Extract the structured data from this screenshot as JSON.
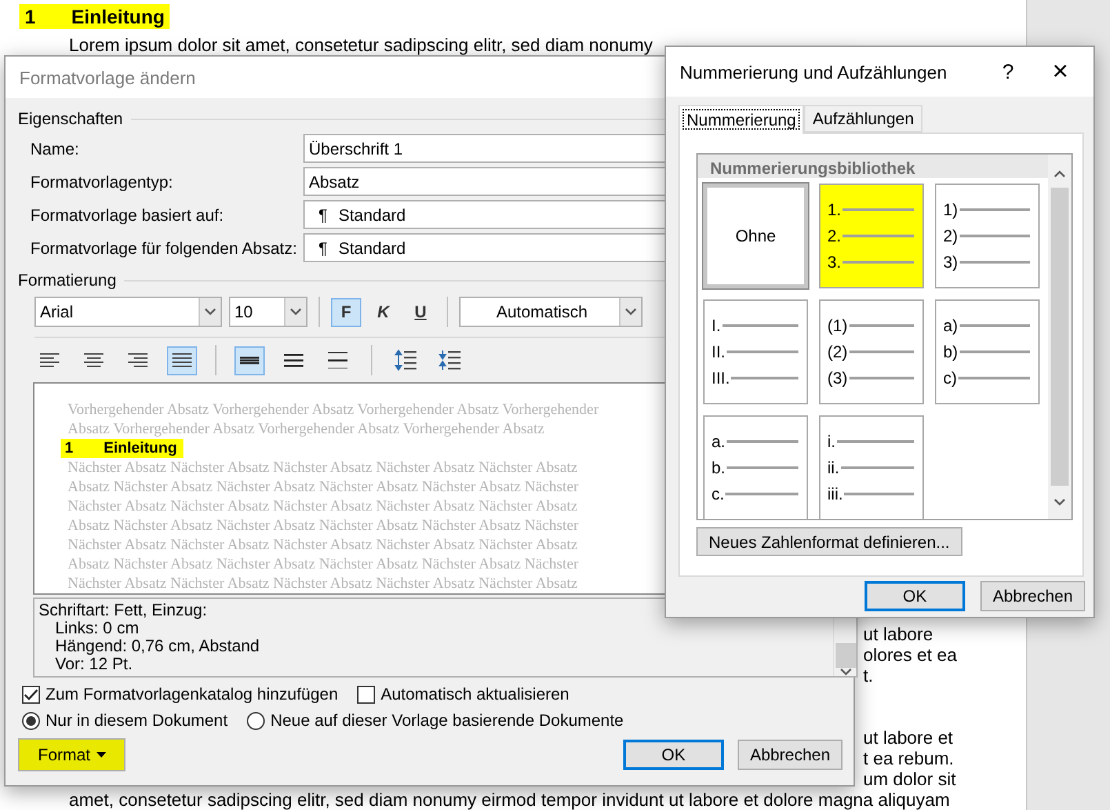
{
  "document": {
    "heading": {
      "number": "1",
      "text": "Einleitung",
      "highlighted": true
    },
    "top_line": "Lorem ipsum dolor sit amet, consetetur sadipscing elitr, sed diam nonumy",
    "fragments_upper": [
      "ut labore",
      "olores et ea",
      "t."
    ],
    "fragments_lower": [
      "ut labore et",
      "t ea rebum.",
      "um dolor sit"
    ],
    "bottom_line": "amet, consetetur sadipscing elitr, sed diam nonumy eirmod tempor invidunt ut labore et dolore magna aliquyam"
  },
  "style_dialog": {
    "title": "Formatvorlage ändern",
    "properties": {
      "label": "Eigenschaften",
      "rows": [
        {
          "label": "Name:",
          "value": "Überschrift 1",
          "kind": "text"
        },
        {
          "label": "Formatvorlagentyp:",
          "value": "Absatz",
          "kind": "text"
        },
        {
          "label": "Formatvorlage basiert auf:",
          "value": "Standard",
          "kind": "style",
          "symbol": "¶"
        },
        {
          "label": "Formatvorlage für folgenden Absatz:",
          "value": "Standard",
          "kind": "style",
          "symbol": "¶"
        }
      ]
    },
    "formatting": {
      "label": "Formatierung",
      "font": "Arial",
      "size": "10",
      "style_buttons": [
        {
          "label": "F",
          "kind": "bold",
          "selected": true
        },
        {
          "label": "K",
          "kind": "italic",
          "selected": false
        },
        {
          "label": "U",
          "kind": "underline",
          "selected": false
        }
      ],
      "color_choice": "Automatisch",
      "alignment": [
        {
          "kind": "left",
          "selected": false
        },
        {
          "kind": "center",
          "selected": false
        },
        {
          "kind": "right",
          "selected": false
        },
        {
          "kind": "justify",
          "selected": true
        }
      ],
      "line_spacing": [
        {
          "kind": "single",
          "selected": true
        },
        {
          "kind": "onehalf",
          "selected": false
        },
        {
          "kind": "double",
          "selected": false
        }
      ],
      "paragraph_spacing": [
        {
          "kind": "increase",
          "selected": false
        },
        {
          "kind": "decrease",
          "selected": false
        }
      ]
    },
    "preview": {
      "before": [
        "Vorhergehender Absatz Vorhergehender Absatz Vorhergehender Absatz Vorhergehender",
        "Absatz Vorhergehender Absatz Vorhergehender Absatz Vorhergehender Absatz"
      ],
      "heading": {
        "number": "1",
        "text": "Einleitung",
        "highlighted": true
      },
      "after": [
        "Nächster Absatz Nächster Absatz Nächster Absatz Nächster Absatz Nächster Absatz",
        "Absatz Nächster Absatz Nächster Absatz Nächster Absatz Nächster Absatz Nächster",
        "Nächster Absatz Nächster Absatz Nächster Absatz Nächster Absatz Nächster Absatz",
        "Absatz Nächster Absatz Nächster Absatz Nächster Absatz Nächster Absatz Nächster",
        "Nächster Absatz Nächster Absatz Nächster Absatz Nächster Absatz Nächster Absatz",
        "Absatz Nächster Absatz Nächster Absatz Nächster Absatz Nächster Absatz Nächster",
        "Nächster Absatz Nächster Absatz Nächster Absatz Nächster Absatz Nächster Absatz"
      ]
    },
    "description": [
      "Schriftart: Fett, Einzug:",
      "Links:  0 cm",
      "Hängend:  0,76 cm, Abstand",
      "Vor:  12 Pt."
    ],
    "checkboxes": [
      {
        "label": "Zum Formatvorlagenkatalog hinzufügen",
        "checked": true
      },
      {
        "label": "Automatisch aktualisieren",
        "checked": false
      }
    ],
    "radios": [
      {
        "label": "Nur in diesem Dokument",
        "selected": true
      },
      {
        "label": "Neue auf dieser Vorlage basierende Dokumente",
        "selected": false
      }
    ],
    "format_button": {
      "label": "Format",
      "highlighted": true
    },
    "buttons": [
      {
        "label": "OK",
        "default": true
      },
      {
        "label": "Abbrechen",
        "default": false
      }
    ]
  },
  "numbering_dialog": {
    "title": "Nummerierung und Aufzählungen",
    "help": "?",
    "close": "×",
    "tabs": [
      {
        "label": "Nummerierung",
        "selected": true
      },
      {
        "label": "Aufzählungen",
        "selected": false
      }
    ],
    "library": {
      "title": "Nummerierungsbibliothek",
      "cells": [
        {
          "kind": "none",
          "label": "Ohne",
          "selected": true,
          "highlighted": false
        },
        {
          "kind": "list",
          "markers": [
            "1.",
            "2.",
            "3."
          ],
          "selected": false,
          "highlighted": true
        },
        {
          "kind": "list",
          "markers": [
            "1)",
            "2)",
            "3)"
          ],
          "selected": false,
          "highlighted": false
        },
        {
          "kind": "list",
          "markers": [
            "I.",
            "II.",
            "III."
          ],
          "selected": false,
          "highlighted": false
        },
        {
          "kind": "list",
          "markers": [
            "(1)",
            "(2)",
            "(3)"
          ],
          "selected": false,
          "highlighted": false
        },
        {
          "kind": "list",
          "markers": [
            "a)",
            "b)",
            "c)"
          ],
          "selected": false,
          "highlighted": false
        },
        {
          "kind": "list",
          "markers": [
            "a.",
            "b.",
            "c."
          ],
          "selected": false,
          "highlighted": false
        },
        {
          "kind": "list",
          "markers": [
            "i.",
            "ii.",
            "iii."
          ],
          "selected": false,
          "highlighted": false
        }
      ]
    },
    "define_button": "Neues Zahlenformat definieren...",
    "buttons": [
      {
        "label": "OK",
        "default": true
      },
      {
        "label": "Abbrechen",
        "default": false
      }
    ]
  }
}
